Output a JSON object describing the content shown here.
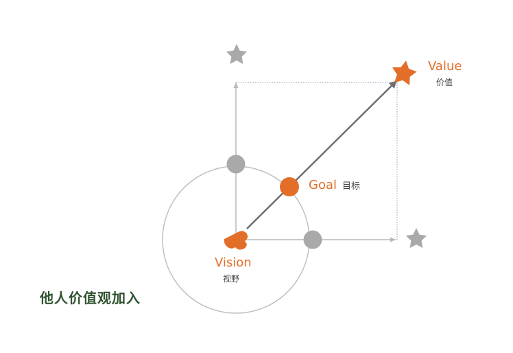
{
  "labels": {
    "value_en": "Value",
    "value_zh": "价值",
    "goal_en": "Goal",
    "goal_zh": "目标",
    "vision_en": "Vision",
    "vision_zh": "视野"
  },
  "caption": "他人价值观加入",
  "colors": {
    "accent_orange": "#e36e27",
    "node_gray": "#a9a9a9",
    "line_gray": "#b9b9b9",
    "arrow_dark": "#6e6e6e",
    "caption_green": "#2f5230",
    "zh_text": "#444444"
  },
  "icons": {
    "value": "star",
    "goal": "circle",
    "vision": "heart",
    "secondary_targets": "star"
  }
}
